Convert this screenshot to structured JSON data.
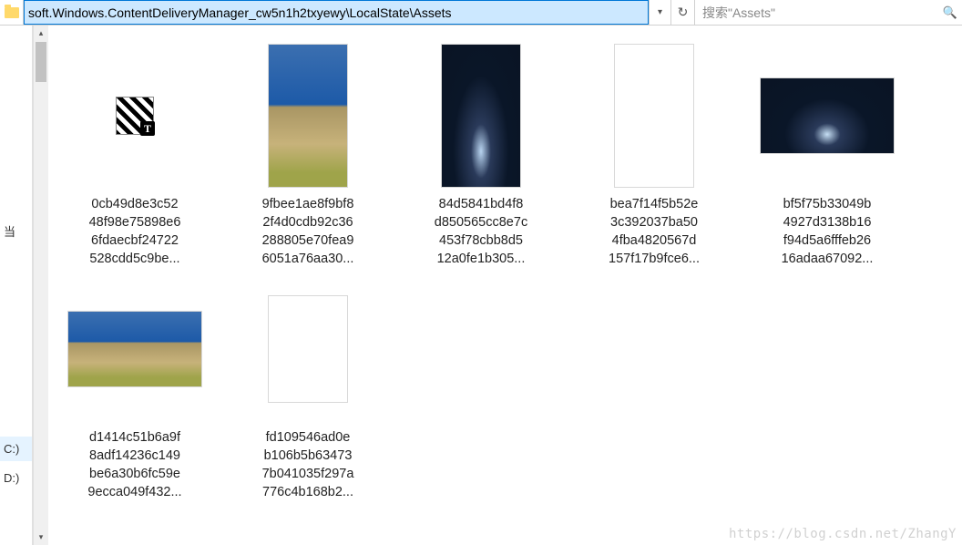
{
  "address_bar": {
    "path": "soft.Windows.ContentDeliveryManager_cw5n1h2txyewy\\LocalState\\Assets"
  },
  "search": {
    "placeholder": "搜索\"Assets\""
  },
  "nav": {
    "top_label": "当",
    "drive_c": "C:)",
    "drive_d": "D:)"
  },
  "files": [
    {
      "name_l1": "0cb49d8e3c52",
      "name_l2": "48f98e75898e6",
      "name_l3": "6fdaecbf24722",
      "name_l4": "528cdd5c9be...",
      "thumb": "crossword"
    },
    {
      "name_l1": "9fbee1ae8f9bf8",
      "name_l2": "2f4d0cdb92c36",
      "name_l3": "288805e70fea9",
      "name_l4": "6051a76aa30...",
      "thumb": "land-p"
    },
    {
      "name_l1": "84d5841bd4f8",
      "name_l2": "d850565cc8e7c",
      "name_l3": "453f78cbb8d5",
      "name_l4": "12a0fe1b305...",
      "thumb": "night-p"
    },
    {
      "name_l1": "bea7f14f5b52e",
      "name_l2": "3c392037ba50",
      "name_l3": "4fba4820567d",
      "name_l4": "157f17b9fce6...",
      "thumb": "white-p"
    },
    {
      "name_l1": "bf5f75b33049b",
      "name_l2": "4927d3138b16",
      "name_l3": "f94d5a6fffeb26",
      "name_l4": "16adaa67092...",
      "thumb": "night-l"
    },
    {
      "name_l1": "d1414c51b6a9f",
      "name_l2": "8adf14236c149",
      "name_l3": "be6a30b6fc59e",
      "name_l4": "9ecca049f432...",
      "thumb": "land-l"
    },
    {
      "name_l1": "fd109546ad0e",
      "name_l2": "b106b5b63473",
      "name_l3": "7b041035f297a",
      "name_l4": "776c4b168b2...",
      "thumb": "white-s"
    }
  ],
  "watermark": "https://blog.csdn.net/ZhangY"
}
